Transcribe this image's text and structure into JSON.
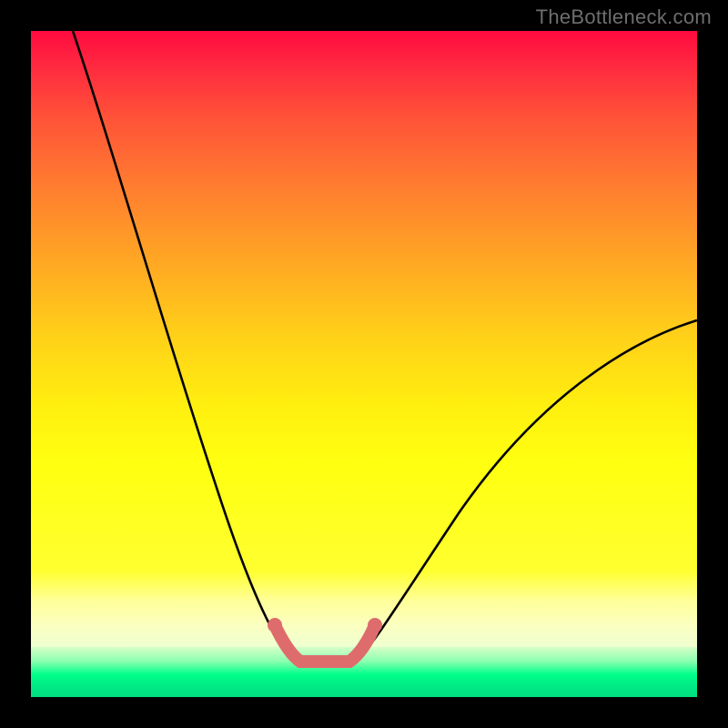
{
  "watermark": "TheBottleneck.com",
  "colors": {
    "frame_bg": "#000000",
    "curve_stroke": "#000000",
    "accent_salmon": "#de6c6c",
    "gradient_top": "#ff0a3e",
    "gradient_mid": "#ffff10",
    "gradient_bottom": "#00e884"
  },
  "chart_data": {
    "type": "line",
    "title": "",
    "xlabel": "",
    "ylabel": "",
    "xlim": [
      0,
      100
    ],
    "ylim": [
      0,
      100
    ],
    "series": [
      {
        "name": "bottleneck-curve-left",
        "x": [
          6,
          10,
          15,
          20,
          25,
          30,
          33,
          36,
          38,
          40
        ],
        "values": [
          100,
          85,
          67,
          49,
          31,
          14,
          6,
          2,
          0.5,
          0
        ]
      },
      {
        "name": "bottleneck-curve-right",
        "x": [
          48,
          50,
          53,
          58,
          65,
          75,
          85,
          95,
          100
        ],
        "values": [
          0,
          0.5,
          2,
          6,
          14,
          27,
          40,
          51,
          57
        ]
      },
      {
        "name": "optimal-flat-segment",
        "x": [
          40,
          48
        ],
        "values": [
          0,
          0
        ]
      }
    ],
    "annotations": [
      {
        "name": "optimal-zone-marker",
        "type": "thick-segment",
        "color": "#de6c6c",
        "x_range": [
          36,
          50
        ],
        "y": 0
      }
    ]
  }
}
